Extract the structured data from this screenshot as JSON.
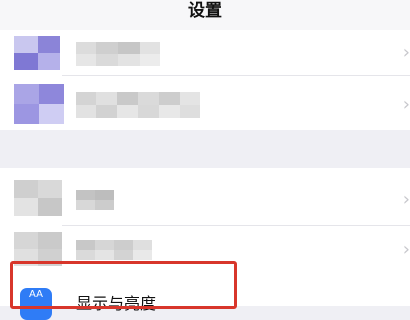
{
  "header": {
    "title": "设置"
  },
  "rows": {
    "display": {
      "label": "显示与亮度",
      "icon_name": "display-brightness-icon",
      "icon_glyph": "AA"
    }
  },
  "chevron_glyph": "›",
  "colors": {
    "highlight": "#d8362b",
    "icon_blue": "#2f7cf6"
  }
}
